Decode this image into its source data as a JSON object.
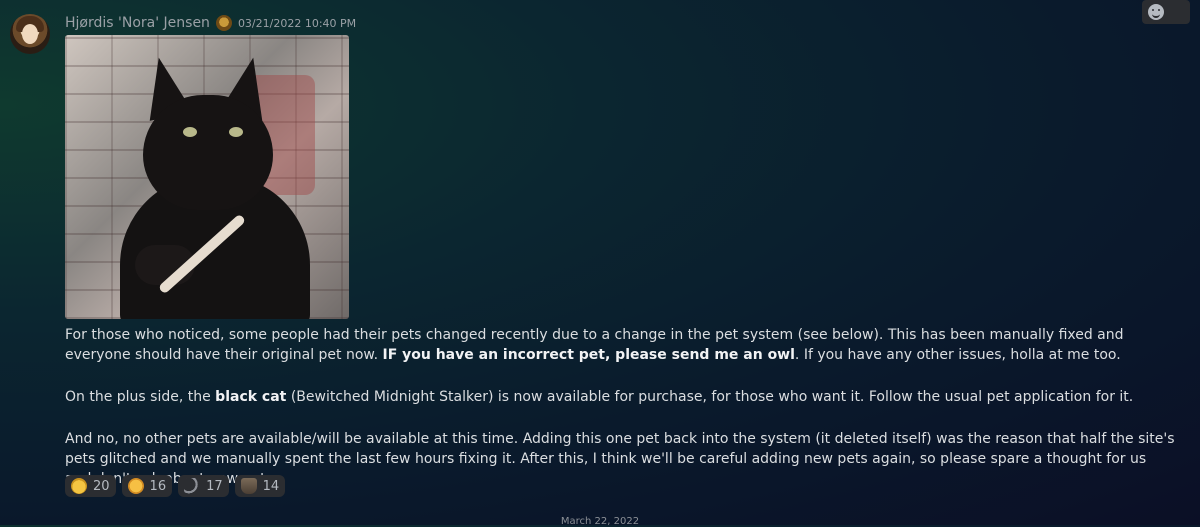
{
  "message": {
    "username": "Hjørdis 'Nora' Jensen",
    "timestamp": "03/21/2022 10:40 PM",
    "paragraphs": [
      {
        "parts": [
          {
            "text": "For those who noticed, some people had their pets changed recently due to a change in the pet system (see below). This has been manually fixed and everyone should have their original pet now. ",
            "bold": false
          },
          {
            "text": "IF you have an incorrect pet, please send me an owl",
            "bold": true
          },
          {
            "text": ". If you have any other issues, holla at me too.",
            "bold": false
          }
        ]
      },
      {
        "parts": [
          {
            "text": "On the plus side, the ",
            "bold": false
          },
          {
            "text": "black cat",
            "bold": true
          },
          {
            "text": " (Bewitched Midnight Stalker) is now available for purchase, for those who want it. Follow the usual pet application for it.",
            "bold": false
          }
        ]
      },
      {
        "parts": [
          {
            "text": "And no, no other pets are available/will be available at this time. Adding this one pet back into the system (it deleted itself) was the reason that half the site's pets glitched and we manually spent the last few hours fixing it. After this, I think we'll be careful adding new pets again, so please spare a thought for us and don't ask about new pets.",
            "bold": false
          }
        ]
      }
    ],
    "reactions": [
      {
        "icon": "thumbs-up-icon",
        "count": "20"
      },
      {
        "icon": "dizzy-face-icon",
        "count": "16"
      },
      {
        "icon": "moon-icon",
        "count": "17"
      },
      {
        "icon": "cauldron-icon",
        "count": "14"
      }
    ]
  },
  "date_divider": "March 22, 2022"
}
